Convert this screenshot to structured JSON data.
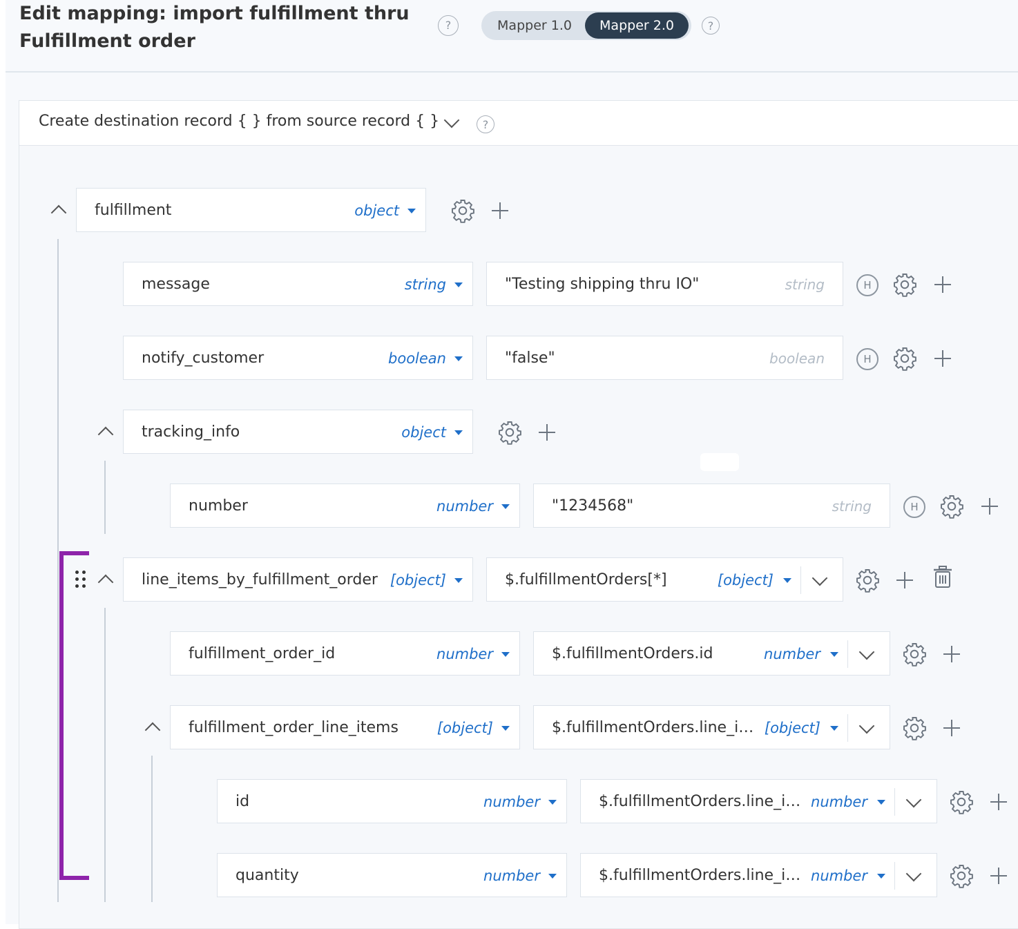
{
  "header": {
    "title_line1": "Edit mapping: import fulfillment thru",
    "title_line2": "Fulfillment order",
    "help_glyph": "?",
    "mapper_options": [
      "Mapper 1.0",
      "Mapper 2.0"
    ],
    "selected_mapper": "Mapper 2.0"
  },
  "panel": {
    "heading": "Create destination record { } from source record { }"
  },
  "icons": {
    "help": "question-circle-icon",
    "settings": "gear-icon",
    "add": "plus-icon",
    "delete": "trash-icon",
    "hardcoded": "h-badge-icon",
    "drag": "drag-handle-icon",
    "collapse": "chevron-up-icon",
    "expand": "chevron-down-icon"
  },
  "badge_letter": "H",
  "colors": {
    "accent": "#1f6fc9",
    "bracket": "#8e24aa",
    "toggle_active": "#2c3e50"
  },
  "rows": {
    "fulfillment": {
      "name": "fulfillment",
      "type": "object"
    },
    "message": {
      "name": "message",
      "type": "string",
      "value": "\"Testing shipping thru IO\"",
      "value_type": "string"
    },
    "notify_customer": {
      "name": "notify_customer",
      "type": "boolean",
      "value": "\"false\"",
      "value_type": "boolean"
    },
    "tracking_info": {
      "name": "tracking_info",
      "type": "object"
    },
    "number": {
      "name": "number",
      "type": "number",
      "value": "\"1234568\"",
      "value_type": "string"
    },
    "line_items": {
      "name": "line_items_by_fulfillment_order",
      "type": "[object]",
      "source": "$.fulfillmentOrders[*]",
      "source_type": "[object]"
    },
    "fo_id": {
      "name": "fulfillment_order_id",
      "type": "number",
      "source": "$.fulfillmentOrders.id",
      "source_type": "number"
    },
    "fo_line_items": {
      "name": "fulfillment_order_line_items",
      "type": "[object]",
      "source": "$.fulfillmentOrders.line_i…",
      "source_type": "[object]"
    },
    "id": {
      "name": "id",
      "type": "number",
      "source": "$.fulfillmentOrders.line_i…",
      "source_type": "number"
    },
    "quantity": {
      "name": "quantity",
      "type": "number",
      "source": "$.fulfillmentOrders.line_i…",
      "source_type": "number"
    }
  }
}
